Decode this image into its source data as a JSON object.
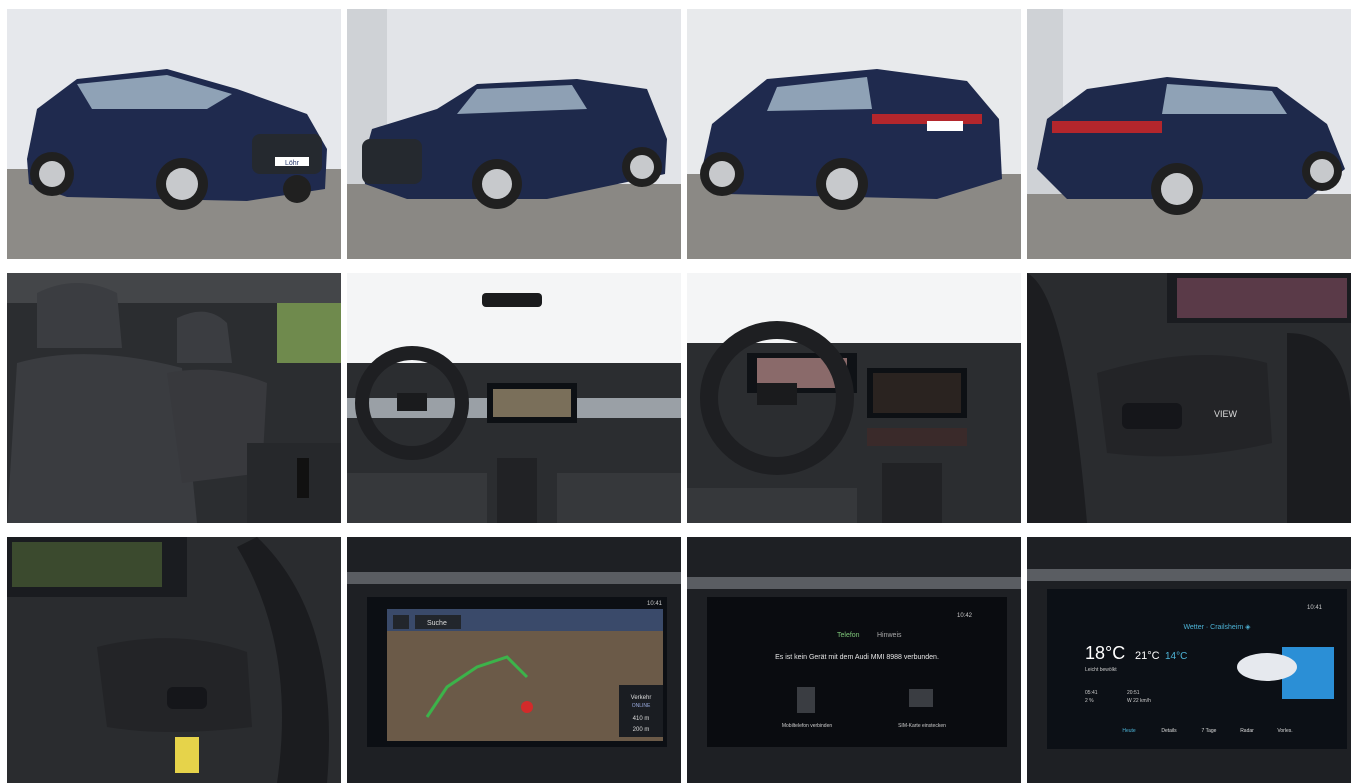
{
  "gallery": {
    "photos": [
      {
        "id": "front-left"
      },
      {
        "id": "front-left-2"
      },
      {
        "id": "rear-left"
      },
      {
        "id": "rear-left-2"
      },
      {
        "id": "front-seats"
      },
      {
        "id": "cockpit"
      },
      {
        "id": "cockpit-2"
      },
      {
        "id": "steering-controls-right"
      },
      {
        "id": "steering-controls-left"
      },
      {
        "id": "mmi-navigation"
      },
      {
        "id": "mmi-phone"
      },
      {
        "id": "mmi-weather"
      }
    ]
  },
  "plate_text": "Löhr",
  "brand_rings": "audi",
  "steering": {
    "view_button": "VIEW"
  },
  "mmi_nav": {
    "status_time": "10:41",
    "search_label": "Suche",
    "traffic_title": "Verkehr",
    "traffic_badge": "ONLINE",
    "dist_1": "410 m",
    "dist_2": "200 m"
  },
  "mmi_phone": {
    "status_time": "10:42",
    "header_left": "Telefon",
    "header_right": "Hinweis",
    "message": "Es ist kein Gerät mit dem Audi MMI 8988 verbunden.",
    "option_1": "Mobiltelefon verbinden",
    "option_2": "SIM-Karte einstecken"
  },
  "mmi_weather": {
    "status_time": "10:41",
    "header": "Wetter · Crailsheim ◈",
    "temp_now": "18°C",
    "temp_range_hi": "21°C",
    "temp_range_lo": "14°C",
    "condition": "Leicht bewölkt",
    "sunrise": "05:41",
    "sunset": "20:51",
    "rain": "2 %",
    "wind": "W 22 km/h",
    "tabs": [
      "Heute",
      "Details",
      "7 Tage",
      "Radar",
      "Vorles."
    ]
  },
  "colors": {
    "car": "#1f2a4e",
    "pavement": "#8c8a86",
    "wall": "#e4e6ea",
    "screen": "#0c0f14",
    "accent": "#4db3d6"
  }
}
